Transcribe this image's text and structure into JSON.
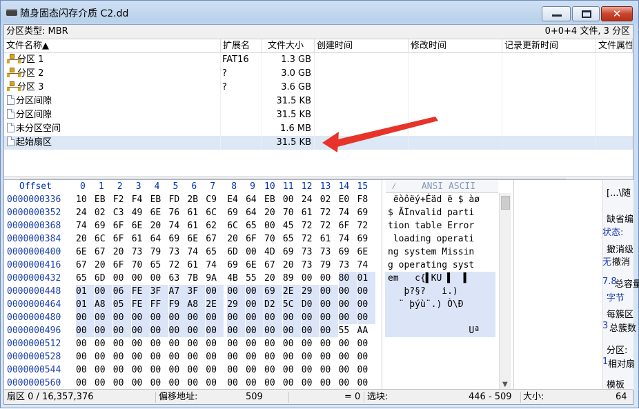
{
  "window": {
    "title": "随身固态闪存介质 C2.dd",
    "min_icon": "minimize-icon",
    "max_icon": "maximize-icon",
    "close_icon": "close-icon",
    "close_glyph": "✕"
  },
  "info": {
    "left": "分区类型: MBR",
    "right": "0+0+4 文件, 3 分区"
  },
  "columns": [
    "文件名称▲",
    "扩展名",
    "文件大小",
    "创建时间",
    "修改时间",
    "记录更新时间",
    "文件属性"
  ],
  "rows": [
    {
      "name": "分区 1",
      "ext": "FAT16",
      "size": "1.3 GB",
      "icon": "partition-icon"
    },
    {
      "name": "分区 2",
      "ext": "?",
      "size": "3.0 GB",
      "icon": "partition-icon"
    },
    {
      "name": "分区 3",
      "ext": "?",
      "size": "3.6 GB",
      "icon": "partition-icon"
    },
    {
      "name": "分区间隙",
      "ext": "",
      "size": "31.5 KB",
      "icon": "file-icon"
    },
    {
      "name": "分区间隙",
      "ext": "",
      "size": "31.5 KB",
      "icon": "file-icon"
    },
    {
      "name": "未分区空间",
      "ext": "",
      "size": "1.6 MB",
      "icon": "file-icon"
    },
    {
      "name": "起始扇区",
      "ext": "",
      "size": "31.5 KB",
      "icon": "file-icon",
      "selected": true
    }
  ],
  "hex": {
    "offset_label": "Offset",
    "col_labels": [
      "0",
      "1",
      "2",
      "3",
      "4",
      "5",
      "6",
      "7",
      "8",
      "9",
      "10",
      "11",
      "12",
      "13",
      "14",
      "15"
    ],
    "ascii_label": "ANSI ASCII",
    "offsets": [
      "0000000336",
      "0000000352",
      "0000000368",
      "0000000384",
      "0000000400",
      "0000000416",
      "0000000432",
      "0000000448",
      "0000000464",
      "0000000480",
      "0000000496",
      "0000000512",
      "0000000528",
      "0000000544",
      "0000000560"
    ],
    "bytes": [
      [
        "10",
        "EB",
        "F2",
        "F4",
        "EB",
        "FD",
        "2B",
        "C9",
        "E4",
        "64",
        "EB",
        "00",
        "24",
        "02",
        "E0",
        "F8"
      ],
      [
        "24",
        "02",
        "C3",
        "49",
        "6E",
        "76",
        "61",
        "6C",
        "69",
        "64",
        "20",
        "70",
        "61",
        "72",
        "74",
        "69"
      ],
      [
        "74",
        "69",
        "6F",
        "6E",
        "20",
        "74",
        "61",
        "62",
        "6C",
        "65",
        "00",
        "45",
        "72",
        "72",
        "6F",
        "72"
      ],
      [
        "20",
        "6C",
        "6F",
        "61",
        "64",
        "69",
        "6E",
        "67",
        "20",
        "6F",
        "70",
        "65",
        "72",
        "61",
        "74",
        "69"
      ],
      [
        "6E",
        "67",
        "20",
        "73",
        "79",
        "73",
        "74",
        "65",
        "6D",
        "00",
        "4D",
        "69",
        "73",
        "73",
        "69",
        "6E"
      ],
      [
        "67",
        "20",
        "6F",
        "70",
        "65",
        "72",
        "61",
        "74",
        "69",
        "6E",
        "67",
        "20",
        "73",
        "79",
        "73",
        "74"
      ],
      [
        "65",
        "6D",
        "00",
        "00",
        "00",
        "63",
        "7B",
        "9A",
        "4B",
        "55",
        "20",
        "89",
        "00",
        "00",
        "80",
        "01"
      ],
      [
        "01",
        "00",
        "06",
        "FE",
        "3F",
        "A7",
        "3F",
        "00",
        "00",
        "00",
        "69",
        "2E",
        "29",
        "00",
        "00",
        "00"
      ],
      [
        "01",
        "A8",
        "05",
        "FE",
        "FF",
        "F9",
        "A8",
        "2E",
        "29",
        "00",
        "D2",
        "5C",
        "D0",
        "00",
        "00",
        "00"
      ],
      [
        "00",
        "00",
        "00",
        "00",
        "00",
        "00",
        "00",
        "00",
        "00",
        "00",
        "00",
        "00",
        "00",
        "00",
        "00",
        "00"
      ],
      [
        "00",
        "00",
        "00",
        "00",
        "00",
        "00",
        "00",
        "00",
        "00",
        "00",
        "00",
        "00",
        "00",
        "00",
        "55",
        "AA"
      ],
      [
        "00",
        "00",
        "00",
        "00",
        "00",
        "00",
        "00",
        "00",
        "00",
        "00",
        "00",
        "00",
        "00",
        "00",
        "00",
        "00"
      ],
      [
        "00",
        "00",
        "00",
        "00",
        "00",
        "00",
        "00",
        "00",
        "00",
        "00",
        "00",
        "00",
        "00",
        "00",
        "00",
        "00"
      ],
      [
        "00",
        "00",
        "00",
        "00",
        "00",
        "00",
        "00",
        "00",
        "00",
        "00",
        "00",
        "00",
        "00",
        "00",
        "00",
        "00"
      ],
      [
        "00",
        "00",
        "00",
        "00",
        "00",
        "00",
        "00",
        "00",
        "00",
        "00",
        "00",
        "00",
        "00",
        "00",
        "00",
        "00"
      ]
    ],
    "ascii": [
      " ëòôëý+Éäd ë $ àø",
      "$ ÃInvalid parti",
      "tion table Error",
      " loading operati",
      "ng system Missin",
      "g operating syst",
      "em   c{▌KU ▌  ▌",
      "   þ?§?   i.)",
      "  ¨ þýù¨.) Ò\\Ð",
      "",
      "               Uª",
      "",
      "",
      "",
      ""
    ]
  },
  "side": {
    "top": "[...\\随",
    "items": [
      "缺省编",
      "撤消级",
      "撤消",
      "总容量",
      "字节",
      "每簇区",
      "总簇数",
      "分区:",
      "相对扇",
      "模板"
    ],
    "blue": [
      "状态:",
      "无",
      "7.8",
      "3",
      "分区:",
      "1"
    ]
  },
  "status": {
    "sector": "扇区 0 / 16,357,376",
    "offset_label": "偏移地址:",
    "offset_value": "509",
    "eq": "= 0",
    "sel_label": "选块:",
    "sel_value": "446 - 509",
    "size_label": "大小:",
    "size_value": "64"
  }
}
